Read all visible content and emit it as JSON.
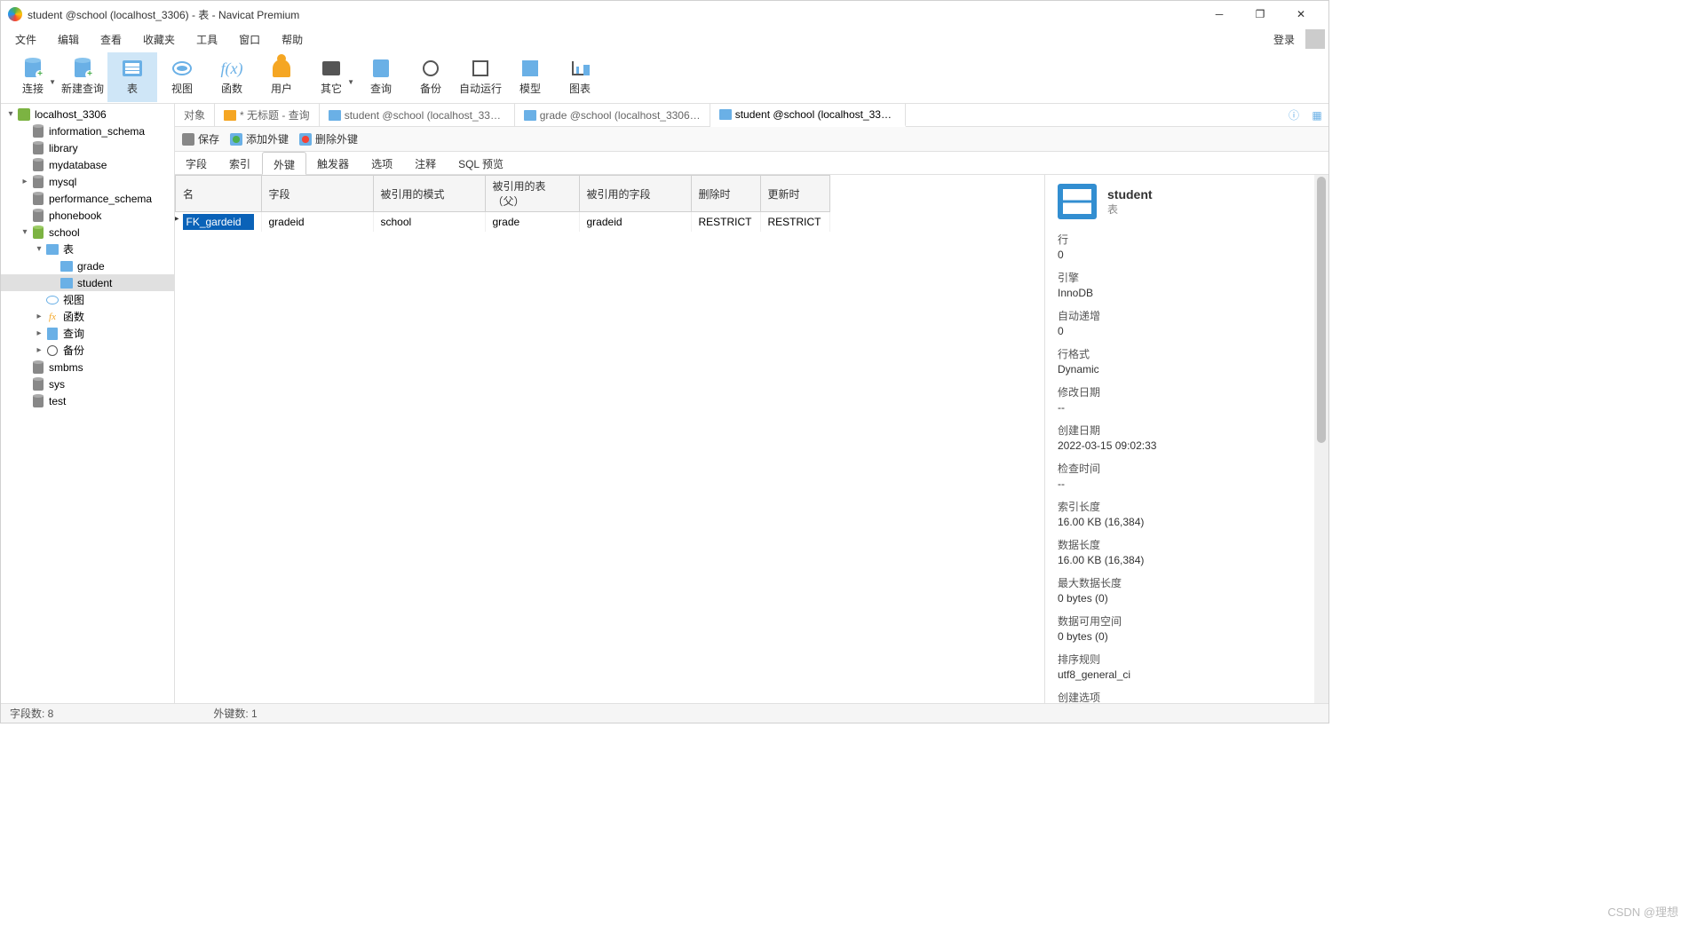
{
  "title": "student @school (localhost_3306) - 表 - Navicat Premium",
  "menu": [
    "文件",
    "编辑",
    "查看",
    "收藏夹",
    "工具",
    "窗口",
    "帮助"
  ],
  "login": "登录",
  "toolbar": [
    {
      "id": "connect",
      "label": "连接",
      "dd": true
    },
    {
      "id": "newquery",
      "label": "新建查询"
    },
    {
      "id": "table",
      "label": "表",
      "active": true
    },
    {
      "id": "view",
      "label": "视图"
    },
    {
      "id": "function",
      "label": "函数"
    },
    {
      "id": "user",
      "label": "用户"
    },
    {
      "id": "other",
      "label": "其它",
      "dd": true
    },
    {
      "id": "query",
      "label": "查询"
    },
    {
      "id": "backup",
      "label": "备份"
    },
    {
      "id": "autorun",
      "label": "自动运行"
    },
    {
      "id": "model",
      "label": "模型"
    },
    {
      "id": "chart",
      "label": "图表"
    }
  ],
  "tree": [
    {
      "d": 0,
      "arr": "▾",
      "ico": "conn",
      "label": "localhost_3306"
    },
    {
      "d": 1,
      "arr": "",
      "ico": "dbs",
      "label": "information_schema"
    },
    {
      "d": 1,
      "arr": "",
      "ico": "dbs",
      "label": "library"
    },
    {
      "d": 1,
      "arr": "",
      "ico": "dbs",
      "label": "mydatabase"
    },
    {
      "d": 1,
      "arr": "▸",
      "ico": "dbs",
      "label": "mysql"
    },
    {
      "d": 1,
      "arr": "",
      "ico": "dbs",
      "label": "performance_schema"
    },
    {
      "d": 1,
      "arr": "",
      "ico": "dbs",
      "label": "phonebook"
    },
    {
      "d": 1,
      "arr": "▾",
      "ico": "dbg",
      "label": "school"
    },
    {
      "d": 2,
      "arr": "▾",
      "ico": "tbls",
      "label": "表"
    },
    {
      "d": 3,
      "arr": "",
      "ico": "tbl",
      "label": "grade"
    },
    {
      "d": 3,
      "arr": "",
      "ico": "tbl",
      "label": "student",
      "sel": true
    },
    {
      "d": 2,
      "arr": "",
      "ico": "vw",
      "label": "视图"
    },
    {
      "d": 2,
      "arr": "▸",
      "ico": "fxs",
      "label": "函数"
    },
    {
      "d": 2,
      "arr": "▸",
      "ico": "qry",
      "label": "查询"
    },
    {
      "d": 2,
      "arr": "▸",
      "ico": "bk",
      "label": "备份"
    },
    {
      "d": 1,
      "arr": "",
      "ico": "dbs",
      "label": "smbms"
    },
    {
      "d": 1,
      "arr": "",
      "ico": "dbs",
      "label": "sys"
    },
    {
      "d": 1,
      "arr": "",
      "ico": "dbs",
      "label": "test"
    }
  ],
  "tabs": [
    {
      "label": "对象",
      "ico": ""
    },
    {
      "label": "* 无标题 - 查询",
      "ico": "q"
    },
    {
      "label": "student @school (localhost_3306)...",
      "ico": "t"
    },
    {
      "label": "grade @school (localhost_3306) -...",
      "ico": "t"
    },
    {
      "label": "student @school (localhost_3306)...",
      "ico": "t",
      "active": true
    }
  ],
  "subtoolbar": {
    "save": "保存",
    "addfk": "添加外键",
    "delfk": "删除外键"
  },
  "subtabs": [
    "字段",
    "索引",
    "外键",
    "触发器",
    "选项",
    "注释",
    "SQL 预览"
  ],
  "subtab_active": 2,
  "grid": {
    "cols": [
      "名",
      "字段",
      "被引用的模式",
      "被引用的表（父）",
      "被引用的字段",
      "删除时",
      "更新时"
    ],
    "widths": [
      88,
      126,
      126,
      106,
      126,
      78,
      78
    ],
    "rows": [
      {
        "name": "FK_gardeid",
        "field": "gradeid",
        "schema": "school",
        "parent": "grade",
        "reffield": "gradeid",
        "ondel": "RESTRICT",
        "onupd": "RESTRICT"
      }
    ]
  },
  "props": {
    "title": "student",
    "sub": "表",
    "items": [
      {
        "k": "行",
        "v": "0"
      },
      {
        "k": "引擎",
        "v": "InnoDB"
      },
      {
        "k": "自动递增",
        "v": "0"
      },
      {
        "k": "行格式",
        "v": "Dynamic"
      },
      {
        "k": "修改日期",
        "v": "--"
      },
      {
        "k": "创建日期",
        "v": "2022-03-15 09:02:33"
      },
      {
        "k": "检查时间",
        "v": "--"
      },
      {
        "k": "索引长度",
        "v": "16.00 KB (16,384)"
      },
      {
        "k": "数据长度",
        "v": "16.00 KB (16,384)"
      },
      {
        "k": "最大数据长度",
        "v": "0 bytes (0)"
      },
      {
        "k": "数据可用空间",
        "v": "0 bytes (0)"
      },
      {
        "k": "排序规则",
        "v": "utf8_general_ci"
      },
      {
        "k": "创建选项",
        "v": ""
      }
    ]
  },
  "status": {
    "fields": "字段数: 8",
    "fks": "外键数: 1"
  },
  "watermark": "CSDN @理想"
}
